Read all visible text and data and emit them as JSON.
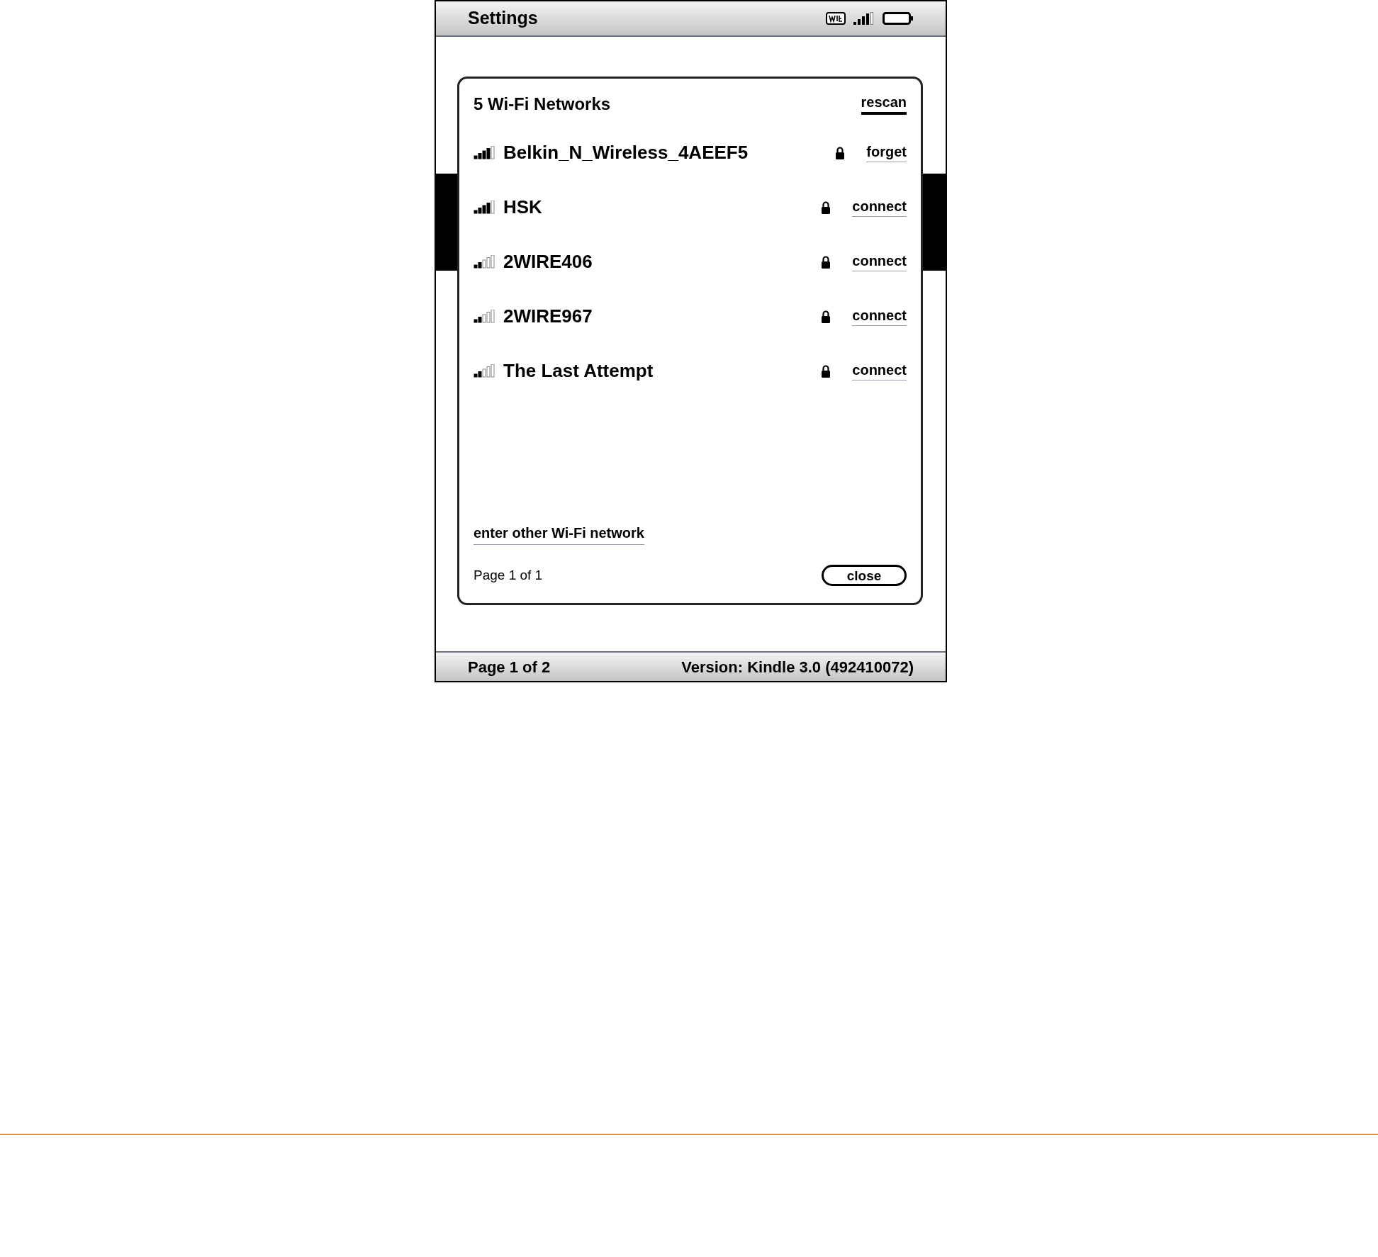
{
  "header": {
    "title": "Settings"
  },
  "dialog": {
    "title": "5 Wi-Fi Networks",
    "rescan": {
      "label": "rescan",
      "selected": true
    },
    "networks": [
      {
        "name": "Belkin_N_Wireless_4AEEF5",
        "level": 0.8,
        "locked": true,
        "action": {
          "label": "forget",
          "selected": false
        }
      },
      {
        "name": "HSK",
        "level": 0.8,
        "locked": true,
        "action": {
          "label": "connect",
          "selected": false
        }
      },
      {
        "name": "2WIRE406",
        "level": 0.4,
        "locked": true,
        "action": {
          "label": "connect",
          "selected": false
        }
      },
      {
        "name": "2WIRE967",
        "level": 0.4,
        "locked": true,
        "action": {
          "label": "connect",
          "selected": false
        }
      },
      {
        "name": "The Last Attempt",
        "level": 0.4,
        "locked": true,
        "action": {
          "label": "connect",
          "selected": false
        }
      }
    ],
    "other_network": "enter other Wi-Fi network",
    "page": "Page 1 of 1",
    "close": "close"
  },
  "footer": {
    "page": "Page 1 of 2",
    "version": "Version: Kindle 3.0 (492410072)"
  }
}
